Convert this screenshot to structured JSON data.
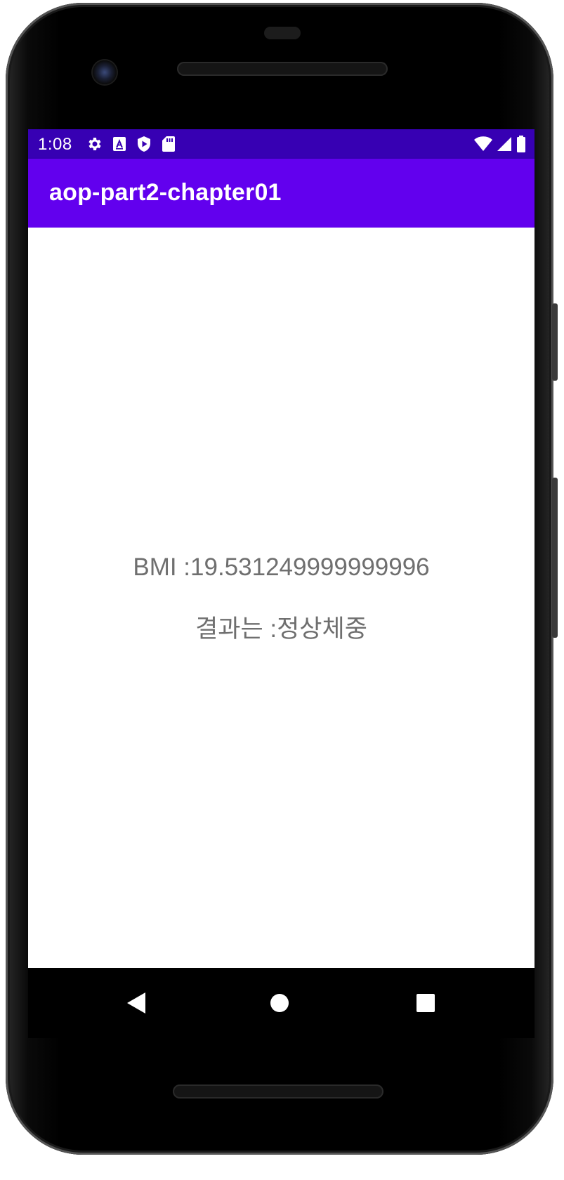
{
  "status_bar": {
    "time": "1:08",
    "left_icons": [
      "settings-icon",
      "a-icon",
      "shield-play-icon",
      "sd-card-icon"
    ],
    "right_icons": [
      "wifi-icon",
      "signal-icon",
      "battery-icon"
    ]
  },
  "app_bar": {
    "title": "aop-part2-chapter01"
  },
  "content": {
    "bmi_text": "BMI :19.531249999999996",
    "result_text": "결과는 :정상체중"
  },
  "nav_bar": {
    "buttons": [
      "back-icon",
      "home-icon",
      "recents-icon"
    ]
  },
  "colors": {
    "status_bar": "#3700b3",
    "app_bar": "#6200ee",
    "text_gray": "#6f6f6f"
  }
}
